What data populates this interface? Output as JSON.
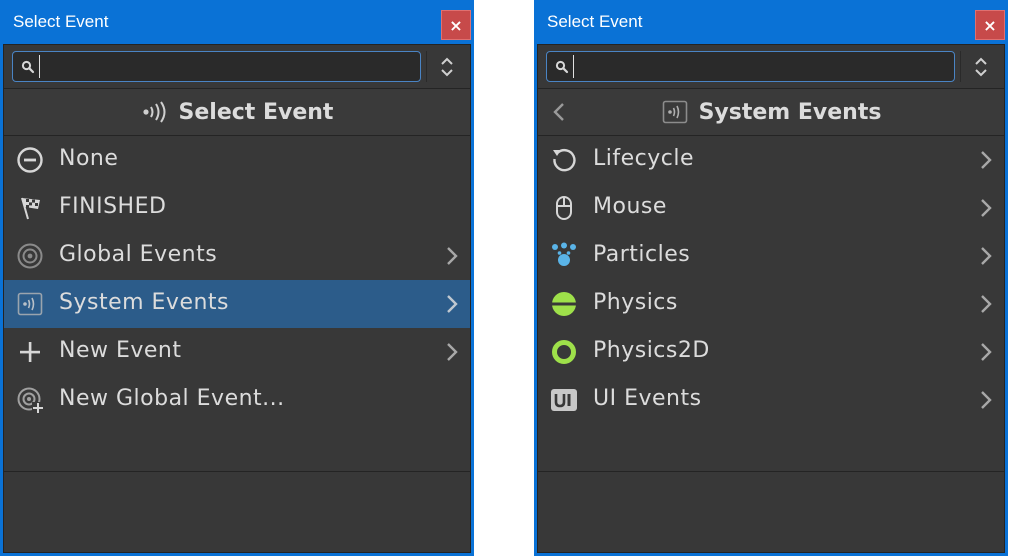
{
  "left": {
    "title": "Select Event",
    "close_glyph": "×",
    "search": {
      "value": "",
      "placeholder": ""
    },
    "header": {
      "title": "Select Event",
      "icon": "broadcast-icon"
    },
    "items": [
      {
        "label": "None",
        "icon": "minus-circle-icon",
        "submenu": false
      },
      {
        "label": "FINISHED",
        "icon": "checkered-flag-icon",
        "submenu": false
      },
      {
        "label": "Global Events",
        "icon": "target-icon",
        "submenu": true
      },
      {
        "label": "System Events",
        "icon": "system-events-icon",
        "submenu": true,
        "selected": true
      },
      {
        "label": "New Event",
        "icon": "plus-icon",
        "submenu": true
      },
      {
        "label": "New Global Event...",
        "icon": "target-plus-icon",
        "submenu": false
      }
    ]
  },
  "right": {
    "title": "Select Event",
    "close_glyph": "×",
    "search": {
      "value": "",
      "placeholder": ""
    },
    "header": {
      "title": "System Events",
      "icon": "system-events-icon"
    },
    "items": [
      {
        "label": "Lifecycle",
        "icon": "cycle-icon",
        "submenu": true
      },
      {
        "label": "Mouse",
        "icon": "mouse-icon",
        "submenu": true
      },
      {
        "label": "Particles",
        "icon": "particles-icon",
        "submenu": true
      },
      {
        "label": "Physics",
        "icon": "physics-icon",
        "submenu": true
      },
      {
        "label": "Physics2D",
        "icon": "physics2d-icon",
        "submenu": true
      },
      {
        "label": "UI Events",
        "icon": "ui-icon",
        "submenu": true
      }
    ]
  },
  "colors": {
    "titlebar": "#0a72d6",
    "close": "#c74a4a",
    "panel": "#383838",
    "selected": "#2c5c8a",
    "text": "#dcdcdc",
    "particles": "#5ab4e8",
    "physics": "#9ee04a"
  }
}
